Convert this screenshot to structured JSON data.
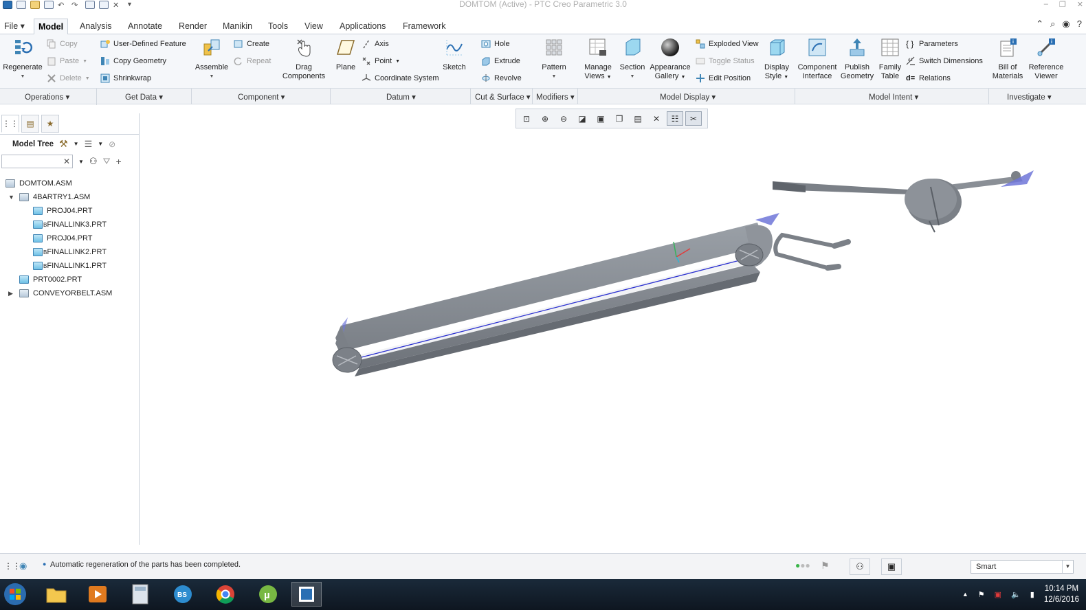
{
  "window": {
    "title": "DOMTOM (Active) - PTC Creo Parametric 3.0"
  },
  "tabs": [
    {
      "label": "File",
      "has_arrow": true
    },
    {
      "label": "Model",
      "active": true
    },
    {
      "label": "Analysis"
    },
    {
      "label": "Annotate"
    },
    {
      "label": "Render"
    },
    {
      "label": "Manikin"
    },
    {
      "label": "Tools"
    },
    {
      "label": "View"
    },
    {
      "label": "Applications"
    },
    {
      "label": "Framework"
    }
  ],
  "file_tab": "File ▾",
  "ribbon": {
    "regenerate": "Regenerate",
    "copy": "Copy",
    "paste": "Paste",
    "delete": "Delete",
    "user_defined_feature": "User-Defined Feature",
    "copy_geometry": "Copy Geometry",
    "shrinkwrap": "Shrinkwrap",
    "assemble": "Assemble",
    "create": "Create",
    "repeat": "Repeat",
    "drag_components_1": "Drag",
    "drag_components_2": "Components",
    "plane": "Plane",
    "axis": "Axis",
    "point": "Point",
    "coordinate_system": "Coordinate System",
    "sketch": "Sketch",
    "hole": "Hole",
    "extrude": "Extrude",
    "revolve": "Revolve",
    "pattern": "Pattern",
    "manage_views_1": "Manage",
    "manage_views_2": "Views",
    "section": "Section",
    "appearance_gallery_1": "Appearance",
    "appearance_gallery_2": "Gallery",
    "exploded_view": "Exploded View",
    "toggle_status": "Toggle Status",
    "edit_position": "Edit Position",
    "display_style_1": "Display",
    "display_style_2": "Style",
    "component_interface_1": "Component",
    "component_interface_2": "Interface",
    "publish_geometry_1": "Publish",
    "publish_geometry_2": "Geometry",
    "family_table_1": "Family",
    "family_table_2": "Table",
    "parameters": "Parameters",
    "switch_dimensions": "Switch Dimensions",
    "relations": "Relations",
    "bill_of_materials_1": "Bill of",
    "bill_of_materials_2": "Materials",
    "reference_viewer_1": "Reference",
    "reference_viewer_2": "Viewer"
  },
  "groups": {
    "operations": "Operations ▾",
    "get_data": "Get Data ▾",
    "component": "Component ▾",
    "datum": "Datum ▾",
    "cut_surface": "Cut & Surface ▾",
    "modifiers": "Modifiers ▾",
    "model_display": "Model Display ▾",
    "model_intent": "Model Intent ▾",
    "investigate": "Investigate ▾"
  },
  "model_tree": {
    "title": "Model Tree",
    "search_placeholder": "",
    "items": [
      {
        "label": "DOMTOM.ASM",
        "type": "asm",
        "level": 0,
        "expander": ""
      },
      {
        "label": "4BARTRY1.ASM",
        "type": "asm",
        "level": 1,
        "expander": "▼"
      },
      {
        "label": "PROJ04.PRT",
        "type": "prt",
        "level": 2,
        "expander": ""
      },
      {
        "label": "FINALLINK3.PRT",
        "type": "prt",
        "level": 2,
        "expander": "",
        "flag": "B"
      },
      {
        "label": "PROJ04.PRT",
        "type": "prt",
        "level": 2,
        "expander": ""
      },
      {
        "label": "FINALLINK2.PRT",
        "type": "prt",
        "level": 2,
        "expander": "",
        "flag": "B"
      },
      {
        "label": "FINALLINK1.PRT",
        "type": "prt",
        "level": 2,
        "expander": "",
        "flag": "B"
      },
      {
        "label": "PRT0002.PRT",
        "type": "prt",
        "level": 1,
        "expander": ""
      },
      {
        "label": "CONVEYORBELT.ASM",
        "type": "asm",
        "level": 1,
        "expander": "▶"
      }
    ]
  },
  "status": {
    "message": "Automatic regeneration of the parts has been completed.",
    "filter_value": "Smart"
  },
  "clock": {
    "time": "10:14 PM",
    "date": "12/6/2016"
  },
  "colors": {
    "model_fill": "#8f949b",
    "model_dark": "#6d7278",
    "datum_blue": "#5b63d6",
    "accent": "#3f85b5"
  }
}
